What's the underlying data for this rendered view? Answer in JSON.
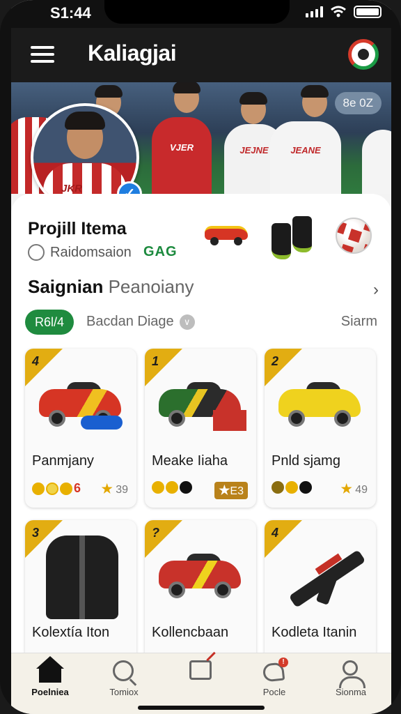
{
  "status": {
    "time": "S1:44"
  },
  "appbar": {
    "title": "Kaliagjai"
  },
  "banner": {
    "badge": "8e 0Z",
    "players": [
      {
        "label": "VJER"
      },
      {
        "label": "JEJNE"
      },
      {
        "label": "JEANE"
      },
      {
        "label": ""
      }
    ],
    "avatar_text": "JKR"
  },
  "profile": {
    "title": "Projill Itema",
    "radio_label": "Raidomsaion",
    "tag": "GAG"
  },
  "section": {
    "title_bold": "Saignian",
    "title_light": "Peanoiany"
  },
  "filters": {
    "chip": "R6l/4",
    "second": "Bacdan Diage",
    "third": "Siarm"
  },
  "items": [
    {
      "num": "4",
      "name": "Panmjany",
      "score_icon": "★",
      "score": "39",
      "dot_colors": [
        "#e8b000",
        "#f0d44a",
        "#e8b000"
      ],
      "dot_suffix": "6",
      "accent": "#d63524"
    },
    {
      "num": "1",
      "name": "Meake Iiaha",
      "score_icon": "★",
      "score": "E3",
      "dot_colors": [
        "#e8b000",
        "#e8b000",
        "#111111"
      ],
      "accent": "#2f8a3a"
    },
    {
      "num": "2",
      "name": "Pnld sjamg",
      "score_icon": "★",
      "score": "49",
      "dot_colors": [
        "#8a6d10",
        "#e8b000",
        "#111111"
      ],
      "accent": "#efd21e"
    },
    {
      "num": "3",
      "name": "Kolextía Iton"
    },
    {
      "num": "?",
      "name": "Kollencbaan"
    },
    {
      "num": "4",
      "name": "Kodleta Itanin"
    }
  ],
  "nav": [
    {
      "label": "Poelniea",
      "icon": "home-icon"
    },
    {
      "label": "Tomiox",
      "icon": "search-icon"
    },
    {
      "label": "",
      "icon": "chat-icon"
    },
    {
      "label": "Pocle",
      "icon": "heart-icon"
    },
    {
      "label": "Sionma",
      "icon": "user-icon"
    }
  ]
}
